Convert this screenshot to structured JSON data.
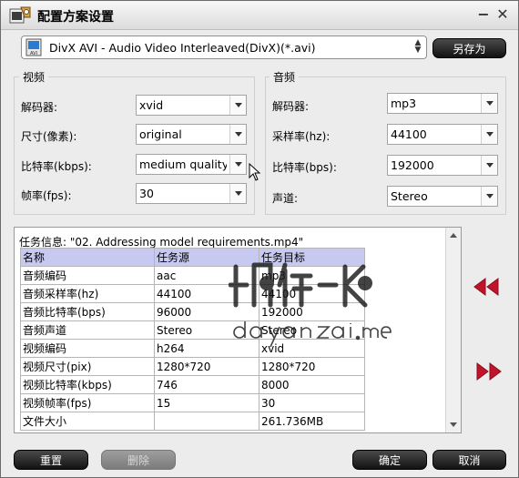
{
  "window": {
    "title": "配置方案设置",
    "minimize": "−",
    "close": "✕"
  },
  "profile": {
    "selected": "DivX AVI - Audio Video Interleaved(DivX)(*.avi)",
    "save_as": "另存为"
  },
  "video": {
    "group_label": "视频",
    "fields": [
      {
        "label": "解码器:",
        "value": "xvid"
      },
      {
        "label": "尺寸(像素):",
        "value": "original"
      },
      {
        "label": "比特率(kbps):",
        "value": "medium quality"
      },
      {
        "label": "帧率(fps):",
        "value": "30"
      }
    ]
  },
  "audio": {
    "group_label": "音频",
    "fields": [
      {
        "label": "解码器:",
        "value": "mp3"
      },
      {
        "label": "采样率(hz):",
        "value": "44100"
      },
      {
        "label": "比特率(bps):",
        "value": "192000"
      },
      {
        "label": "声道:",
        "value": "Stereo"
      }
    ]
  },
  "task_info": {
    "title": "任务信息: \"02. Addressing model requirements.mp4\"",
    "headers": [
      "名称",
      "任务源",
      "任务目标"
    ],
    "rows": [
      [
        "音频编码",
        "aac",
        "mp3"
      ],
      [
        "音频采样率(hz)",
        "44100",
        "44100"
      ],
      [
        "音频比特率(bps)",
        "96000",
        "192000"
      ],
      [
        "音频声道",
        "Stereo",
        "Stereo"
      ],
      [
        "视频编码",
        "h264",
        "xvid"
      ],
      [
        "视频尺寸(pix)",
        "1280*720",
        "1280*720"
      ],
      [
        "视频比特率(kbps)",
        "746",
        "8000"
      ],
      [
        "视频帧率(fps)",
        "15",
        "30"
      ],
      [
        "文件大小",
        "",
        "261.736MB"
      ]
    ]
  },
  "buttons": {
    "reset": "重置",
    "delete": "删除",
    "ok": "确定",
    "cancel": "取消"
  },
  "colors": {
    "arrow_red": "#c0142a",
    "table_header": "#c7c9f0"
  }
}
